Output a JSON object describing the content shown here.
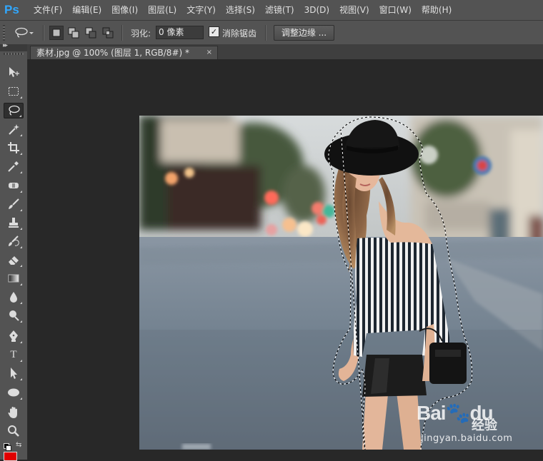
{
  "app": {
    "logo": "Ps"
  },
  "menu": {
    "items": [
      "文件(F)",
      "编辑(E)",
      "图像(I)",
      "图层(L)",
      "文字(Y)",
      "选择(S)",
      "滤镜(T)",
      "3D(D)",
      "视图(V)",
      "窗口(W)",
      "帮助(H)"
    ]
  },
  "options": {
    "tool_icon": "lasso-icon",
    "feather_label": "羽化:",
    "feather_value": "0 像素",
    "anti_alias_checked": true,
    "anti_alias_label": "消除锯齿",
    "refine_edge_label": "调整边缘 ..."
  },
  "document": {
    "tab_label": "素材.jpg @ 100% (图层 1, RGB/8#) *",
    "close_symbol": "×"
  },
  "toolbar": {
    "collapse_symbol": "▸▸",
    "active_tool": "lasso-tool",
    "tools": [
      "move-tool",
      "marquee-tool",
      "lasso-tool",
      "magic-wand-tool",
      "crop-tool",
      "eyedropper-tool",
      "spot-healing-tool",
      "brush-tool",
      "clone-stamp-tool",
      "history-brush-tool",
      "eraser-tool",
      "gradient-tool",
      "blur-tool",
      "dodge-tool",
      "pen-tool",
      "type-tool",
      "path-selection-tool",
      "ellipse-tool",
      "hand-tool",
      "zoom-tool"
    ],
    "type_tool_glyph": "T",
    "foreground_color": "#e00000"
  },
  "watermark": {
    "logo": "Bai",
    "logo_paw": "🐾",
    "logo_suffix": "du",
    "sub": "经验",
    "url": "jingyan.baidu.com"
  }
}
